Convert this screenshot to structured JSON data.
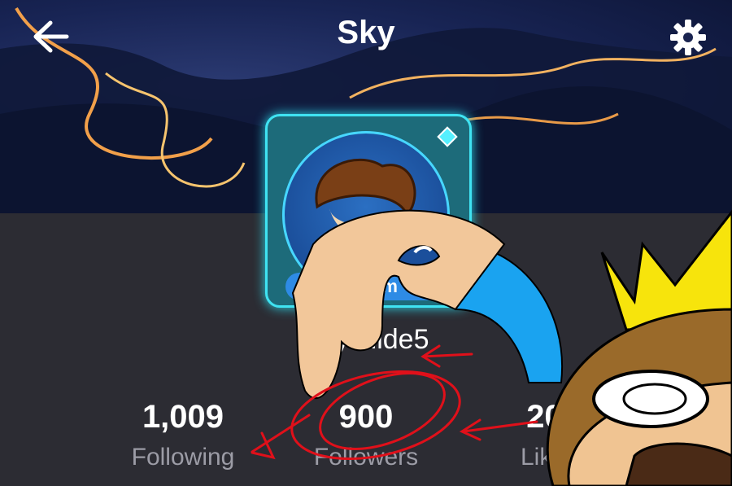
{
  "header": {
    "title": "Sky",
    "back_icon": "arrow-left-icon",
    "settings_icon": "gear-icon"
  },
  "profile": {
    "pronoun_badge": "He/Him",
    "username": "SkyGlide5"
  },
  "stats": [
    {
      "value": "1,009",
      "label": "Following"
    },
    {
      "value": "900",
      "label": "Followers"
    },
    {
      "value": "20,",
      "label": "Likes"
    }
  ],
  "colors": {
    "panel_bg": "#2c2c33",
    "accent_cyan": "#3fe3f2",
    "badge_blue": "#2e8be5",
    "annotation_red": "#e0101a"
  }
}
